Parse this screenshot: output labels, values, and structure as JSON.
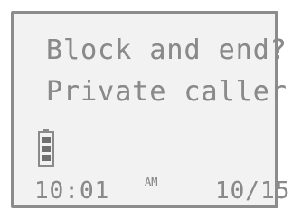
{
  "lcd": {
    "line1": "Block and end?",
    "line2": "Private caller",
    "time": "10:01",
    "am_pm": "AM",
    "date": "10/15"
  },
  "battery": {
    "icon": "battery-icon",
    "level_bars": 3
  },
  "colors": {
    "lcd_text": "#8a8a8a",
    "bezel": "#8c8c8c",
    "background": "#f2f2f2"
  }
}
